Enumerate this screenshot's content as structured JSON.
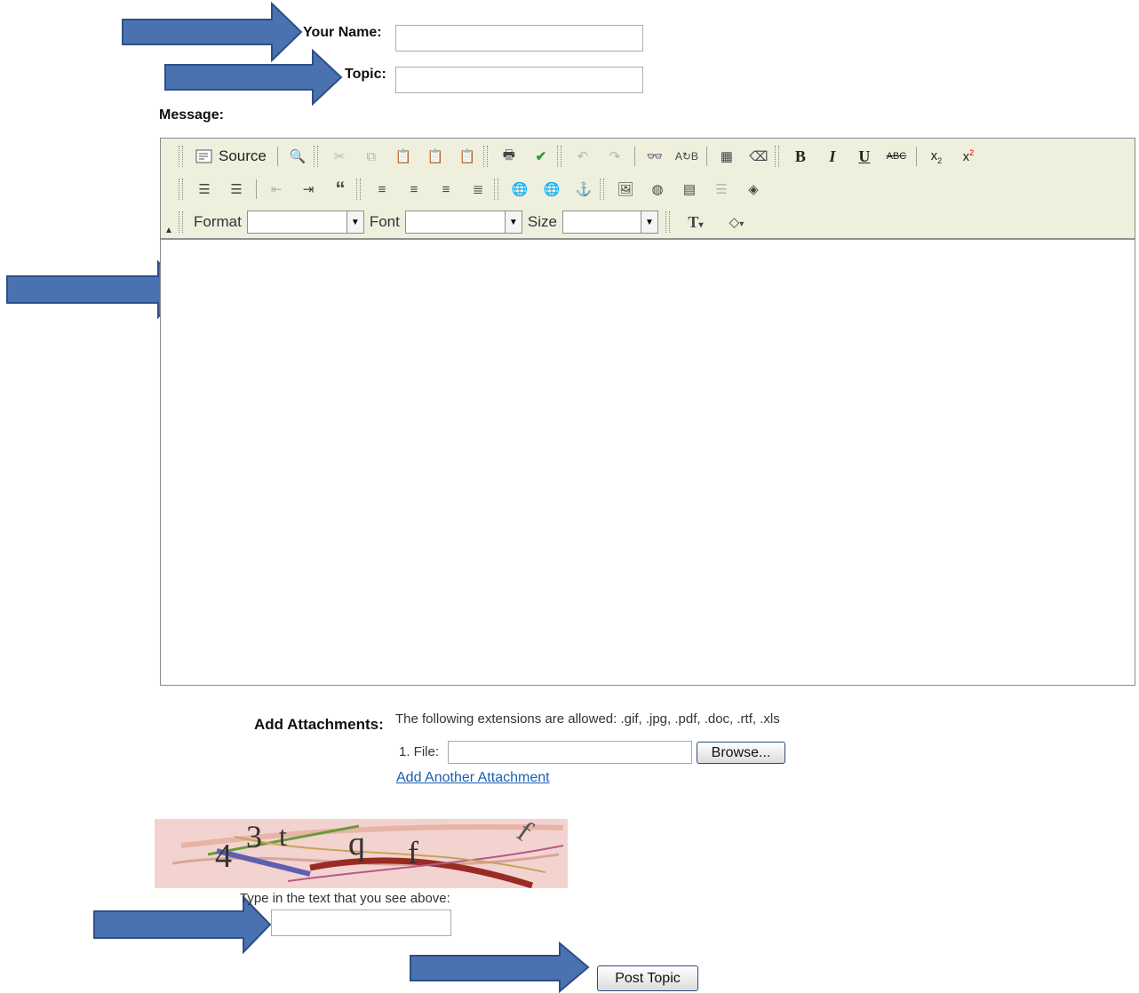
{
  "form": {
    "name_label": "Your Name:",
    "name_value": "",
    "topic_label": "Topic:",
    "topic_value": "",
    "message_label": "Message:"
  },
  "editor": {
    "source_label": "Source",
    "format_label": "Format",
    "font_label": "Font",
    "size_label": "Size",
    "toolbar_row1_icons": [
      "source",
      "preview",
      "cut",
      "copy",
      "paste",
      "paste-text",
      "paste-word",
      "print",
      "spellcheck",
      "undo",
      "redo",
      "find",
      "replace",
      "select-all",
      "remove-format",
      "bold",
      "italic",
      "underline",
      "strike",
      "subscript",
      "superscript"
    ],
    "toolbar_row2_icons": [
      "numbered-list",
      "bullet-list",
      "outdent",
      "indent",
      "blockquote",
      "align-left",
      "align-center",
      "align-right",
      "justify",
      "link",
      "unlink",
      "anchor",
      "image",
      "flash",
      "table",
      "horizontal-rule",
      "special-char"
    ],
    "toolbar_row3_icons": [
      "text-color",
      "background-color"
    ]
  },
  "attachments": {
    "label": "Add Attachments:",
    "allowed_text": "The following extensions are allowed: .gif, .jpg, .pdf, .doc, .rtf, .xls",
    "file_label": "1. File:",
    "browse_label": "Browse...",
    "add_another_label": "Add Another Attachment"
  },
  "captcha": {
    "chars": [
      "4",
      "3",
      "t",
      "q",
      "f",
      "f"
    ],
    "prompt": "Type in the text that you see above:",
    "input_value": ""
  },
  "submit": {
    "label": "Post Topic"
  },
  "colors": {
    "arrow_fill": "#4a72b0",
    "arrow_stroke": "#2e4f86",
    "toolbar_bg": "#efefde",
    "link": "#1a5fb4"
  }
}
